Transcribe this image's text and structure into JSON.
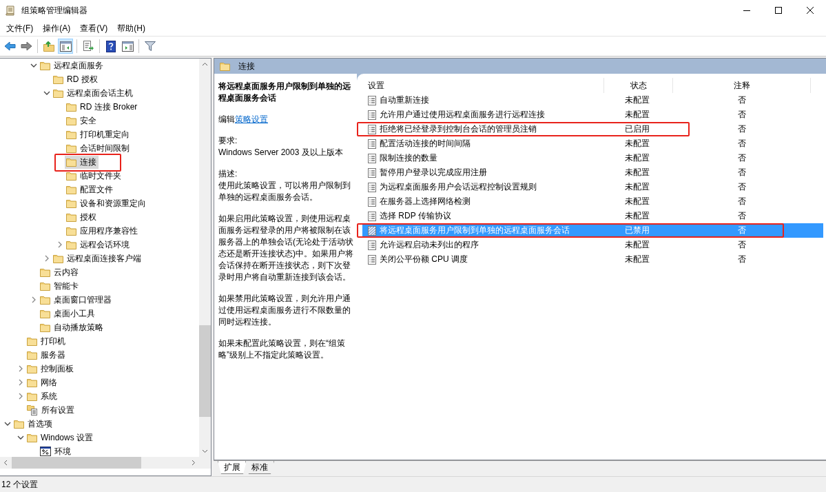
{
  "window": {
    "title": "组策略管理编辑器"
  },
  "menu": [
    "文件(F)",
    "操作(A)",
    "查看(V)",
    "帮助(H)"
  ],
  "toolbar": [
    [
      {
        "kind": "back",
        "pressed": false
      },
      {
        "kind": "forward",
        "pressed": false
      }
    ],
    [
      {
        "kind": "up-folder",
        "pressed": false
      },
      {
        "kind": "tree-pane",
        "pressed": true
      }
    ],
    [
      {
        "kind": "export",
        "pressed": false
      }
    ],
    [
      {
        "kind": "help",
        "pressed": false
      },
      {
        "kind": "action-pane",
        "pressed": false
      }
    ],
    [
      {
        "kind": "filter",
        "pressed": false
      }
    ]
  ],
  "tree": [
    {
      "children": [
        {
          "children": [
            {
              "label": "远程桌面服务",
              "kind": "folder",
              "expanded": true,
              "selected": false,
              "annotated": false,
              "children": [
                {
                  "label": "RD 授权",
                  "kind": "folder",
                  "selected": false,
                  "annotated": false
                },
                {
                  "label": "远程桌面会话主机",
                  "kind": "folder",
                  "expanded": true,
                  "selected": false,
                  "annotated": false,
                  "children": [
                    {
                      "label": "RD 连接 Broker",
                      "kind": "folder",
                      "selected": false,
                      "annotated": false
                    },
                    {
                      "label": "安全",
                      "kind": "folder",
                      "selected": false,
                      "annotated": false
                    },
                    {
                      "label": "打印机重定向",
                      "kind": "folder",
                      "selected": false,
                      "annotated": false
                    },
                    {
                      "label": "会话时间限制",
                      "kind": "folder",
                      "selected": false,
                      "annotated": false
                    },
                    {
                      "label": "连接",
                      "kind": "folder",
                      "selected": true,
                      "annotated": true
                    },
                    {
                      "label": "临时文件夹",
                      "kind": "folder",
                      "selected": false,
                      "annotated": false
                    },
                    {
                      "label": "配置文件",
                      "kind": "folder",
                      "selected": false,
                      "annotated": false
                    },
                    {
                      "label": "设备和资源重定向",
                      "kind": "folder",
                      "selected": false,
                      "annotated": false
                    },
                    {
                      "label": "授权",
                      "kind": "folder",
                      "selected": false,
                      "annotated": false
                    },
                    {
                      "label": "应用程序兼容性",
                      "kind": "folder",
                      "selected": false,
                      "annotated": false
                    },
                    {
                      "label": "远程会话环境",
                      "kind": "folder",
                      "expanded": false,
                      "selected": false,
                      "annotated": false
                    }
                  ]
                },
                {
                  "label": "远程桌面连接客户端",
                  "kind": "folder",
                  "expanded": false,
                  "selected": false,
                  "annotated": false
                }
              ]
            },
            {
              "label": "云内容",
              "kind": "folder",
              "selected": false,
              "annotated": false
            },
            {
              "label": "智能卡",
              "kind": "folder",
              "selected": false,
              "annotated": false
            },
            {
              "label": "桌面窗口管理器",
              "kind": "folder",
              "expanded": false,
              "selected": false,
              "annotated": false
            },
            {
              "label": "桌面小工具",
              "kind": "folder",
              "selected": false,
              "annotated": false
            },
            {
              "label": "自动播放策略",
              "kind": "folder",
              "selected": false,
              "annotated": false
            }
          ]
        },
        {
          "label": "打印机",
          "kind": "folder",
          "selected": false,
          "annotated": false
        },
        {
          "label": "服务器",
          "kind": "folder",
          "selected": false,
          "annotated": false
        },
        {
          "label": "控制面板",
          "kind": "folder",
          "expanded": false,
          "selected": false,
          "annotated": false
        },
        {
          "label": "网络",
          "kind": "folder",
          "expanded": false,
          "selected": false,
          "annotated": false
        },
        {
          "label": "系统",
          "kind": "folder",
          "expanded": false,
          "selected": false,
          "annotated": false
        },
        {
          "label": "所有设置",
          "kind": "all-settings",
          "selected": false,
          "annotated": false
        }
      ]
    },
    {
      "label": "首选项",
      "kind": "folder",
      "expanded": true,
      "selected": false,
      "annotated": false,
      "children": [
        {
          "label": "Windows 设置",
          "kind": "folder",
          "expanded": true,
          "selected": false,
          "annotated": false,
          "children": [
            {
              "label": "环境",
              "kind": "environment",
              "selected": false,
              "annotated": false
            }
          ]
        }
      ]
    }
  ],
  "panel": {
    "title": "连接"
  },
  "description": {
    "title": "将远程桌面服务用户限制到单独的远程桌面服务会话",
    "edit_label": "编辑",
    "edit_link": "策略设置",
    "blocks": [
      {
        "kind": "labeled",
        "label": "要求:",
        "text": "Windows Server 2003 及以上版本"
      },
      {
        "kind": "labeled",
        "label": "描述:",
        "text": "使用此策略设置，可以将用户限制到单独的远程桌面服务会话。"
      },
      {
        "kind": "plain",
        "text": "如果启用此策略设置，则使用远程桌面服务远程登录的用户将被限制在该服务器上的单独会话(无论处于活动状态还是断开连接状态)中。如果用户将会话保持在断开连接状态，则下次登录时用户将自动重新连接到该会话。"
      },
      {
        "kind": "plain",
        "text": "如果禁用此策略设置，则允许用户通过使用远程桌面服务进行不限数量的同时远程连接。"
      },
      {
        "kind": "plain",
        "text": "如果未配置此策略设置，则在“组策略”级别上不指定此策略设置。"
      }
    ]
  },
  "table": {
    "columns": [
      "设置",
      "状态",
      "注释"
    ],
    "rows": [
      {
        "name": "自动重新连接",
        "status": "未配置",
        "note": "否",
        "selected": false,
        "annotated": false
      },
      {
        "name": "允许用户通过使用远程桌面服务进行远程连接",
        "status": "未配置",
        "note": "否",
        "selected": false,
        "annotated": false
      },
      {
        "name": "拒绝将已经登录到控制台会话的管理员注销",
        "status": "已启用",
        "note": "否",
        "selected": false,
        "annotated": true
      },
      {
        "name": "配置活动连接的时间间隔",
        "status": "未配置",
        "note": "否",
        "selected": false,
        "annotated": false
      },
      {
        "name": "限制连接的数量",
        "status": "未配置",
        "note": "否",
        "selected": false,
        "annotated": false
      },
      {
        "name": "暂停用户登录以完成应用注册",
        "status": "未配置",
        "note": "否",
        "selected": false,
        "annotated": false
      },
      {
        "name": "为远程桌面服务用户会话远程控制设置规则",
        "status": "未配置",
        "note": "否",
        "selected": false,
        "annotated": false
      },
      {
        "name": "在服务器上选择网络检测",
        "status": "未配置",
        "note": "否",
        "selected": false,
        "annotated": false
      },
      {
        "name": "选择 RDP 传输协议",
        "status": "未配置",
        "note": "否",
        "selected": false,
        "annotated": false
      },
      {
        "name": "将远程桌面服务用户限制到单独的远程桌面服务会话",
        "status": "已禁用",
        "note": "否",
        "selected": true,
        "annotated": true
      },
      {
        "name": "允许远程启动未列出的程序",
        "status": "未配置",
        "note": "否",
        "selected": false,
        "annotated": false
      },
      {
        "name": "关闭公平份额 CPU 调度",
        "status": "未配置",
        "note": "否",
        "selected": false,
        "annotated": false
      }
    ]
  },
  "tabs": [
    {
      "label": "扩展",
      "selected": true
    },
    {
      "label": "标准",
      "selected": false
    }
  ],
  "status_bar": "12 个设置"
}
